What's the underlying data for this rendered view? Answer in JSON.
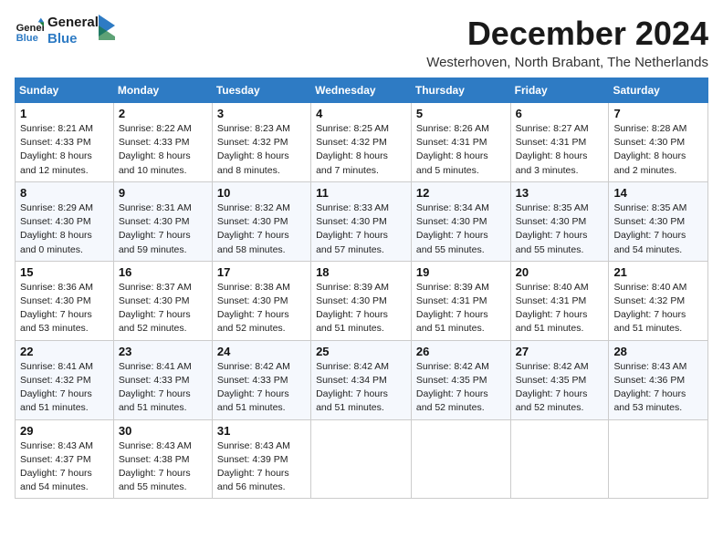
{
  "logo": {
    "line1": "General",
    "line2": "Blue"
  },
  "title": "December 2024",
  "location": "Westerhoven, North Brabant, The Netherlands",
  "days_of_week": [
    "Sunday",
    "Monday",
    "Tuesday",
    "Wednesday",
    "Thursday",
    "Friday",
    "Saturday"
  ],
  "weeks": [
    [
      {
        "day": "1",
        "sunrise": "8:21 AM",
        "sunset": "4:33 PM",
        "daylight": "8 hours and 12 minutes."
      },
      {
        "day": "2",
        "sunrise": "8:22 AM",
        "sunset": "4:33 PM",
        "daylight": "8 hours and 10 minutes."
      },
      {
        "day": "3",
        "sunrise": "8:23 AM",
        "sunset": "4:32 PM",
        "daylight": "8 hours and 8 minutes."
      },
      {
        "day": "4",
        "sunrise": "8:25 AM",
        "sunset": "4:32 PM",
        "daylight": "8 hours and 7 minutes."
      },
      {
        "day": "5",
        "sunrise": "8:26 AM",
        "sunset": "4:31 PM",
        "daylight": "8 hours and 5 minutes."
      },
      {
        "day": "6",
        "sunrise": "8:27 AM",
        "sunset": "4:31 PM",
        "daylight": "8 hours and 3 minutes."
      },
      {
        "day": "7",
        "sunrise": "8:28 AM",
        "sunset": "4:30 PM",
        "daylight": "8 hours and 2 minutes."
      }
    ],
    [
      {
        "day": "8",
        "sunrise": "8:29 AM",
        "sunset": "4:30 PM",
        "daylight": "8 hours and 0 minutes."
      },
      {
        "day": "9",
        "sunrise": "8:31 AM",
        "sunset": "4:30 PM",
        "daylight": "7 hours and 59 minutes."
      },
      {
        "day": "10",
        "sunrise": "8:32 AM",
        "sunset": "4:30 PM",
        "daylight": "7 hours and 58 minutes."
      },
      {
        "day": "11",
        "sunrise": "8:33 AM",
        "sunset": "4:30 PM",
        "daylight": "7 hours and 57 minutes."
      },
      {
        "day": "12",
        "sunrise": "8:34 AM",
        "sunset": "4:30 PM",
        "daylight": "7 hours and 55 minutes."
      },
      {
        "day": "13",
        "sunrise": "8:35 AM",
        "sunset": "4:30 PM",
        "daylight": "7 hours and 55 minutes."
      },
      {
        "day": "14",
        "sunrise": "8:35 AM",
        "sunset": "4:30 PM",
        "daylight": "7 hours and 54 minutes."
      }
    ],
    [
      {
        "day": "15",
        "sunrise": "8:36 AM",
        "sunset": "4:30 PM",
        "daylight": "7 hours and 53 minutes."
      },
      {
        "day": "16",
        "sunrise": "8:37 AM",
        "sunset": "4:30 PM",
        "daylight": "7 hours and 52 minutes."
      },
      {
        "day": "17",
        "sunrise": "8:38 AM",
        "sunset": "4:30 PM",
        "daylight": "7 hours and 52 minutes."
      },
      {
        "day": "18",
        "sunrise": "8:39 AM",
        "sunset": "4:30 PM",
        "daylight": "7 hours and 51 minutes."
      },
      {
        "day": "19",
        "sunrise": "8:39 AM",
        "sunset": "4:31 PM",
        "daylight": "7 hours and 51 minutes."
      },
      {
        "day": "20",
        "sunrise": "8:40 AM",
        "sunset": "4:31 PM",
        "daylight": "7 hours and 51 minutes."
      },
      {
        "day": "21",
        "sunrise": "8:40 AM",
        "sunset": "4:32 PM",
        "daylight": "7 hours and 51 minutes."
      }
    ],
    [
      {
        "day": "22",
        "sunrise": "8:41 AM",
        "sunset": "4:32 PM",
        "daylight": "7 hours and 51 minutes."
      },
      {
        "day": "23",
        "sunrise": "8:41 AM",
        "sunset": "4:33 PM",
        "daylight": "7 hours and 51 minutes."
      },
      {
        "day": "24",
        "sunrise": "8:42 AM",
        "sunset": "4:33 PM",
        "daylight": "7 hours and 51 minutes."
      },
      {
        "day": "25",
        "sunrise": "8:42 AM",
        "sunset": "4:34 PM",
        "daylight": "7 hours and 51 minutes."
      },
      {
        "day": "26",
        "sunrise": "8:42 AM",
        "sunset": "4:35 PM",
        "daylight": "7 hours and 52 minutes."
      },
      {
        "day": "27",
        "sunrise": "8:42 AM",
        "sunset": "4:35 PM",
        "daylight": "7 hours and 52 minutes."
      },
      {
        "day": "28",
        "sunrise": "8:43 AM",
        "sunset": "4:36 PM",
        "daylight": "7 hours and 53 minutes."
      }
    ],
    [
      {
        "day": "29",
        "sunrise": "8:43 AM",
        "sunset": "4:37 PM",
        "daylight": "7 hours and 54 minutes."
      },
      {
        "day": "30",
        "sunrise": "8:43 AM",
        "sunset": "4:38 PM",
        "daylight": "7 hours and 55 minutes."
      },
      {
        "day": "31",
        "sunrise": "8:43 AM",
        "sunset": "4:39 PM",
        "daylight": "7 hours and 56 minutes."
      },
      null,
      null,
      null,
      null
    ]
  ]
}
